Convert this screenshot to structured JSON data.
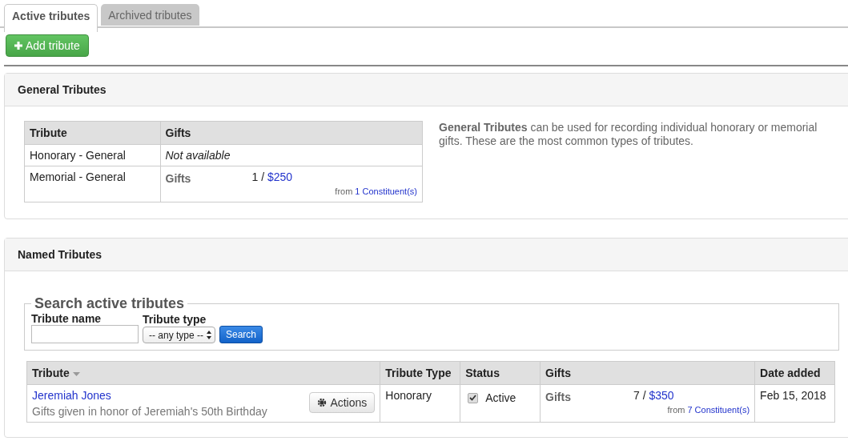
{
  "tabs": [
    {
      "label": "Active tributes",
      "selected": true
    },
    {
      "label": "Archived tributes",
      "selected": false
    }
  ],
  "add_button": {
    "label": "Add tribute"
  },
  "general": {
    "title": "General Tributes",
    "columns": [
      "Tribute",
      "Gifts"
    ],
    "rows": [
      {
        "kind": "unavailable",
        "tribute": "Honorary - General",
        "gifts": "Not available"
      },
      {
        "kind": "gifts",
        "tribute": "Memorial - General",
        "gifts_label": "Gifts",
        "count": "1 /",
        "amount": "$250",
        "from": "from",
        "constituents": "1 Constituent(s)"
      }
    ],
    "description_bold": "General Tributes",
    "description": "can be used for recording individual honorary or memorial gifts. These are the most common types of tributes."
  },
  "named": {
    "title": "Named Tributes",
    "search": {
      "legend": "Search active tributes",
      "name_label": "Tribute name",
      "type_label": "Tribute type",
      "type_value": "-- any type --",
      "button": "Search"
    },
    "columns": [
      "Tribute",
      "Tribute Type",
      "Status",
      "Gifts",
      "Date added"
    ],
    "rows": [
      {
        "name": "Jeremiah Jones",
        "note": "Gifts given in honor of Jeremiah's 50th Birthday",
        "actions": "Actions",
        "type": "Honorary",
        "active": true,
        "status": "Active",
        "gifts_label": "Gifts",
        "count": "7 /",
        "amount": "$350",
        "from": "from",
        "constituents": "7 Constituent(s)",
        "date": "Feb 15, 2018"
      }
    ]
  }
}
